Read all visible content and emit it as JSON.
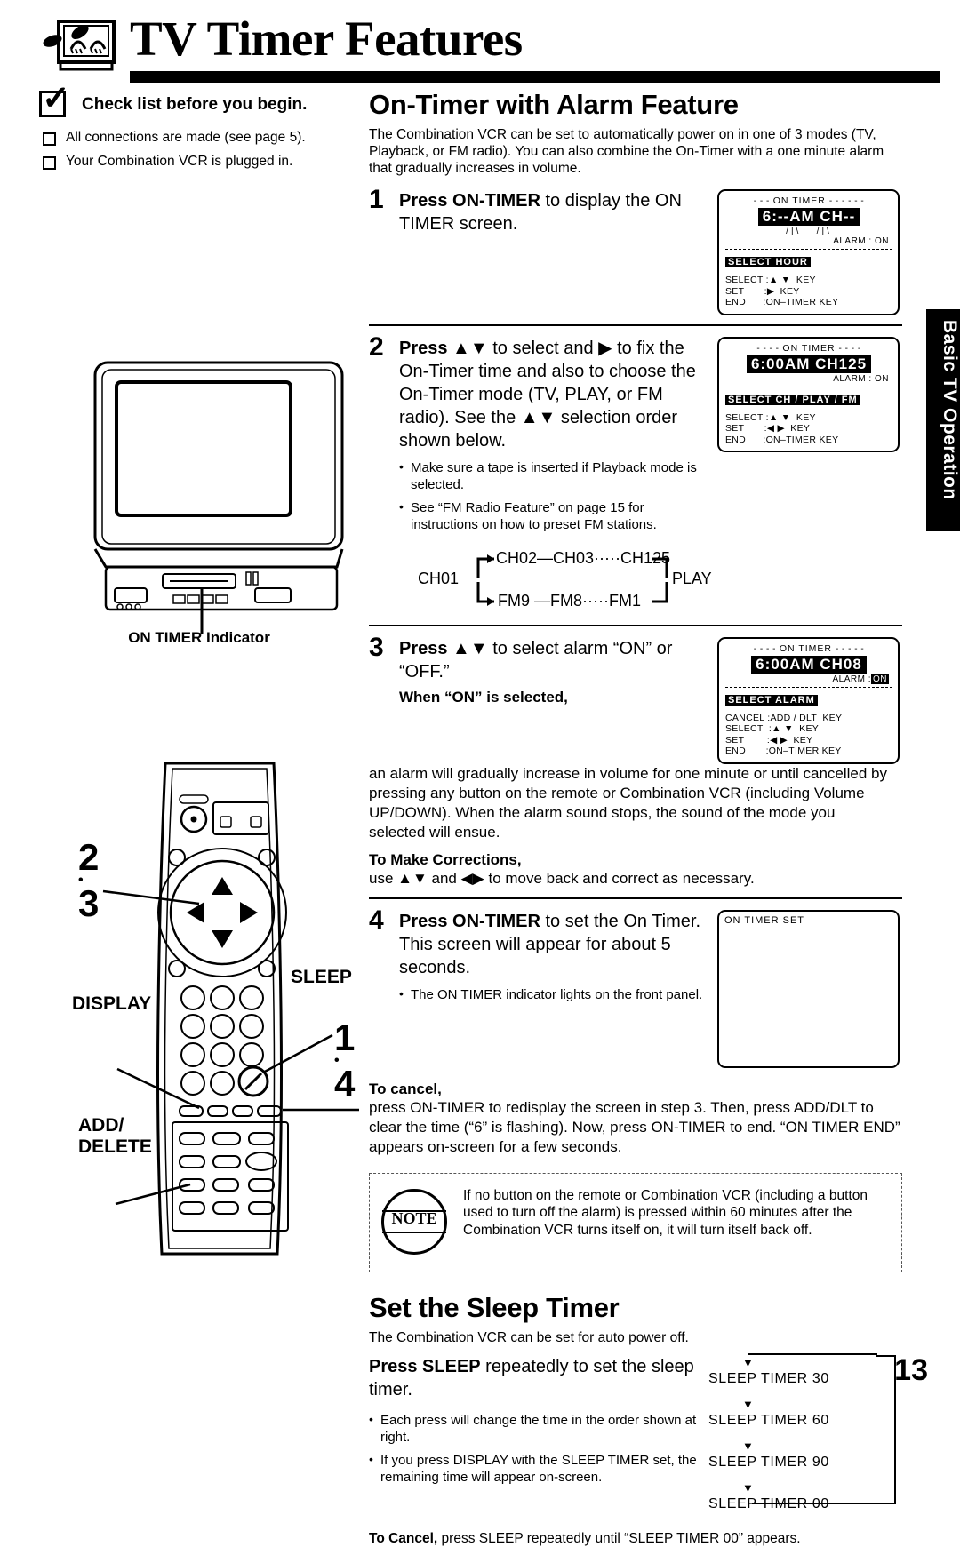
{
  "header": {
    "title": "TV Timer Features",
    "icon": "tv-sleep-icon"
  },
  "checklist": {
    "heading": "Check list before you begin.",
    "items": [
      "All connections are made (see page 5).",
      "Your Combination VCR is plugged in."
    ]
  },
  "illustrations": {
    "tv_caption": "ON TIMER Indicator",
    "remote_callouts": {
      "arrows": "2\n3",
      "display": "DISPLAY",
      "sleep": "SLEEP",
      "on_timer": "1\n4",
      "add_delete": "ADD/\nDELETE"
    }
  },
  "section1": {
    "title": "On-Timer with Alarm Feature",
    "intro": "The Combination VCR can be set to automatically power on in one of 3 modes (TV, Playback, or FM radio). You can also combine the On-Timer with a one minute alarm that gradually increases in volume.",
    "step1": {
      "num": "1",
      "bold": "Press ON-TIMER",
      "rest": " to display the ON TIMER screen."
    },
    "step2": {
      "num": "2",
      "bold": "Press",
      "rest": " ▲▼ to select and ▶ to fix the On-Timer time and also to choose the On-Timer mode (TV, PLAY, or FM radio). See the ▲▼ selection order shown below.",
      "bullets": [
        "Make sure a tape is inserted if Playback mode is selected.",
        "See “FM Radio Feature” on page 15 for instructions on how to preset FM stations."
      ]
    },
    "step3": {
      "num": "3",
      "bold": "Press",
      "rest": " ▲▼ to select alarm “ON” or “OFF.”",
      "subhead": "When “ON” is selected,",
      "body": "an alarm will gradually increase in volume for one minute or until cancelled by pressing any button on the remote or Combination VCR (including Volume UP/DOWN). When the alarm sound stops, the sound of the mode you selected will ensue.",
      "corrections_head": "To Make Corrections,",
      "corrections_body": "use ▲▼ and ◀▶ to move back and correct as necessary."
    },
    "step4": {
      "num": "4",
      "bold": "Press ON-TIMER",
      "rest": " to set the On Timer. This screen will appear for about 5 seconds.",
      "bullets": [
        "The ON TIMER indicator lights on the front panel."
      ],
      "cancel_head": "To cancel,",
      "cancel_body": "press ON-TIMER to redisplay the screen in step 3. Then, press ADD/DLT to clear the time (“6” is flashing). Now, press ON-TIMER to end. “ON TIMER END” appears on-screen for a few seconds."
    },
    "channel_order": {
      "left": "CH01",
      "top_seq": "CH02—CH03·····CH125",
      "bottom_seq": "FM9 —FM8·····FM1",
      "right": "PLAY"
    },
    "osd_screens": [
      {
        "name": "osd-select-hour",
        "title": "ON TIMER",
        "time": "6:--AM  CH--",
        "alarm": "ALARM : ON",
        "mode": "SELECT HOUR",
        "keys": [
          "SELECT :▲ ▼  KEY",
          "SET       :▶  KEY",
          "END      :ON–TIMER KEY"
        ]
      },
      {
        "name": "osd-select-ch-play-fm",
        "title": "ON  TIMER",
        "time": "6:00AM  CH125",
        "alarm": "ALARM : ON",
        "mode": "SELECT CH / PLAY / FM",
        "keys": [
          "SELECT :▲ ▼  KEY",
          "SET       :◀ ▶  KEY",
          "END      :ON–TIMER KEY"
        ]
      },
      {
        "name": "osd-select-alarm",
        "title": "ON  TIMER",
        "time": "6:00AM  CH08",
        "alarm_prefix": "ALARM :",
        "alarm_value": "ON",
        "mode": "SELECT ALARM",
        "keys": [
          "CANCEL :ADD / DLT  KEY",
          "SELECT  :▲ ▼  KEY",
          "SET        :◀ ▶  KEY",
          "END       :ON–TIMER KEY"
        ]
      },
      {
        "name": "osd-on-timer-set",
        "text": "ON TIMER SET"
      }
    ],
    "note": {
      "word": "NOTE",
      "text": "If no button on the remote or Combination VCR (including a button used to turn off the alarm) is pressed within 60 minutes after the Combination VCR turns itself on, it will turn itself back off."
    }
  },
  "section2": {
    "title": "Set the Sleep Timer",
    "intro": "The Combination VCR can be set for auto power off.",
    "instruction_bold": "Press SLEEP",
    "instruction_rest": " repeatedly to set the sleep timer.",
    "bullets": [
      "Each press will change the time in the order shown at right.",
      "If you press DISPLAY with the SLEEP TIMER set, the remaining time will appear on-screen."
    ],
    "sleep_sequence": [
      "SLEEP TIMER 30",
      "SLEEP TIMER 60",
      "SLEEP TIMER 90",
      "SLEEP TIMER 00"
    ],
    "to_cancel_bold": "To Cancel,",
    "to_cancel_rest": " press SLEEP repeatedly until “SLEEP TIMER 00” appears."
  },
  "side_tab": "Basic TV Operation",
  "page_number": "13"
}
